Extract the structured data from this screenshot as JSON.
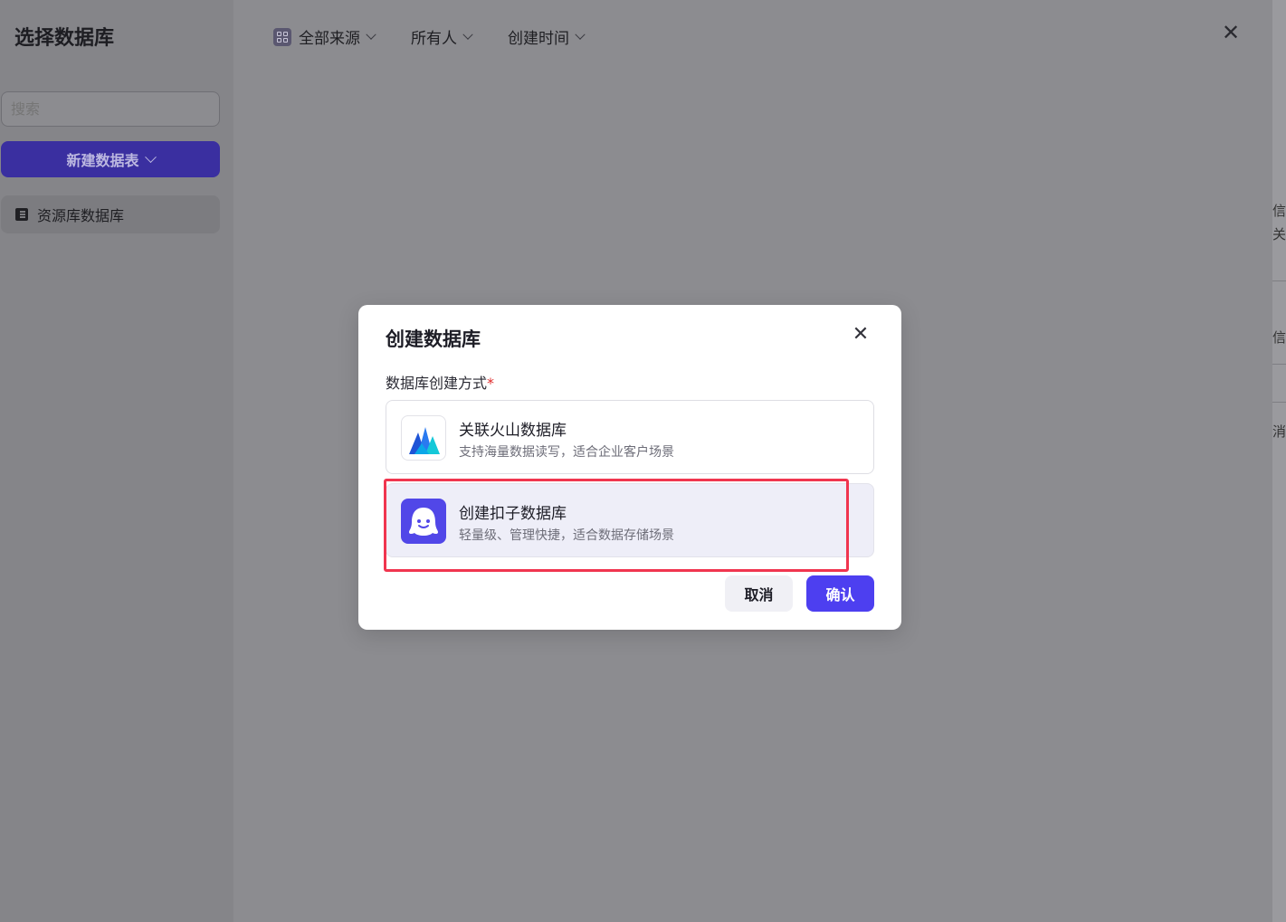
{
  "sidebar": {
    "title": "选择数据库",
    "search_placeholder": "搜索",
    "new_table_button": "新建数据表",
    "items": [
      {
        "label": "资源库数据库",
        "icon": "database-icon"
      }
    ]
  },
  "filters": [
    {
      "label": "全部来源",
      "icon": "source-grid-icon"
    },
    {
      "label": "所有人"
    },
    {
      "label": "创建时间"
    }
  ],
  "background_fragments": [
    "信息",
    "关",
    "信息中",
    "消息"
  ],
  "modal": {
    "title": "创建数据库",
    "field_label": "数据库创建方式",
    "required_mark": "*",
    "options": [
      {
        "title": "关联火山数据库",
        "description": "支持海量数据读写，适合企业客户场景",
        "icon": "volcano-mountain-icon",
        "selected": false
      },
      {
        "title": "创建扣子数据库",
        "description": "轻量级、管理快捷，适合数据存储场景",
        "icon": "coze-ghost-icon",
        "selected": true
      }
    ],
    "cancel_label": "取消",
    "confirm_label": "确认"
  },
  "colors": {
    "primary": "#4d3ff0",
    "highlight": "#f0354f",
    "overlay": "#8c8c90"
  }
}
